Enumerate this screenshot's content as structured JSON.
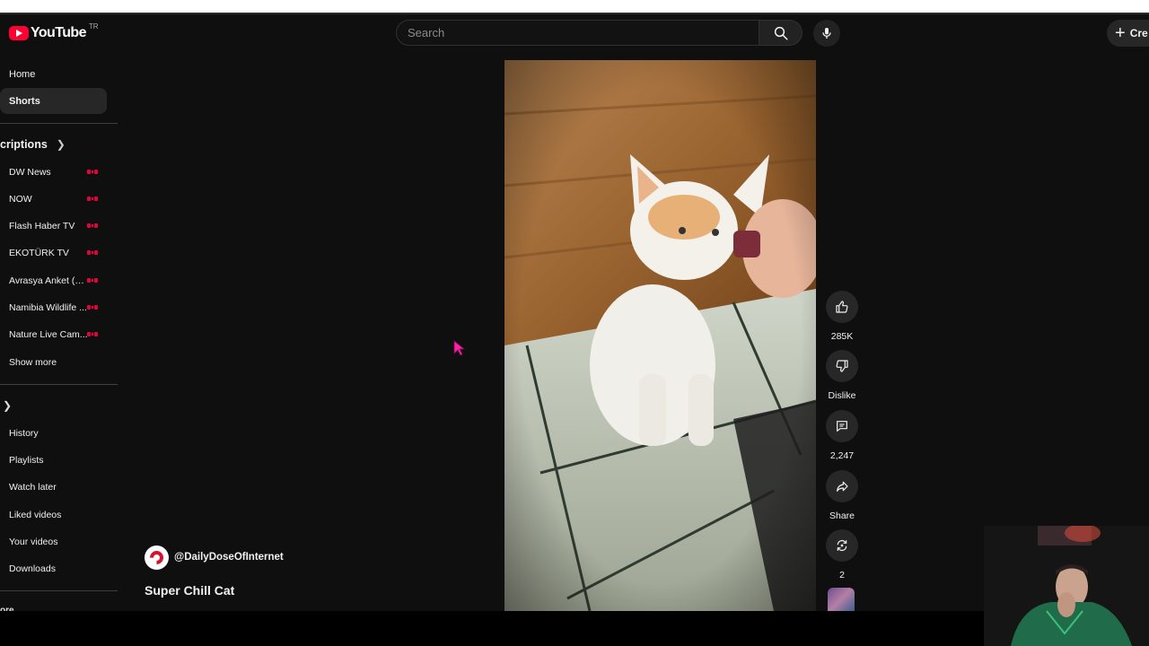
{
  "header": {
    "logo_text": "YouTube",
    "country_code": "TR",
    "search_placeholder": "Search",
    "create_label": "Cre"
  },
  "sidebar": {
    "main_items": [
      {
        "label": "Home",
        "active": false
      },
      {
        "label": "Shorts",
        "active": true
      }
    ],
    "subscriptions_title": "criptions",
    "subscriptions": [
      {
        "label": "DW News",
        "live": true
      },
      {
        "label": "NOW",
        "live": true
      },
      {
        "label": "Flash Haber TV",
        "live": true
      },
      {
        "label": "EKOTÜRK TV",
        "live": true
      },
      {
        "label": "Avrasya Anket (K...",
        "live": true
      },
      {
        "label": "Namibia Wildlife ...",
        "live": true
      },
      {
        "label": "Nature Live Cam...",
        "live": true
      }
    ],
    "show_more": "Show more",
    "you_items": [
      {
        "label": "History"
      },
      {
        "label": "Playlists"
      },
      {
        "label": "Watch later"
      },
      {
        "label": "Liked videos"
      },
      {
        "label": "Your videos"
      },
      {
        "label": "Downloads"
      }
    ],
    "cut_label": "ore"
  },
  "short": {
    "channel_handle": "@DailyDoseOfInternet",
    "title": "Super Chill Cat",
    "actions": {
      "like": "285K",
      "dislike": "Dislike",
      "comments": "2,247",
      "share": "Share",
      "remix": "2"
    }
  },
  "colors": {
    "background": "#0f0f0f",
    "brand_red": "#ff0033",
    "live_red": "#e8003d",
    "button_bg": "#272727",
    "cursor_magenta": "#ff1fa8"
  }
}
